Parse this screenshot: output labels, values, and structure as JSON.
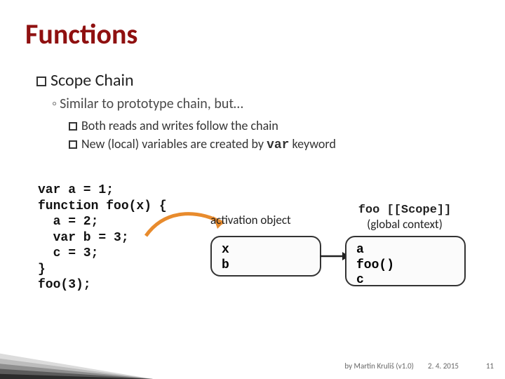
{
  "title": "Functions",
  "heading": "Scope Chain",
  "sub": "Similar to prototype chain, but…",
  "bullets": {
    "b1": "Both reads and writes follow the chain",
    "b2_a": "New (local) variables are created by ",
    "b2_code": "var",
    "b2_b": " keyword"
  },
  "code": "var a = 1;\nfunction foo(x) {\n  a = 2;\n  var b = 3;\n  c = 3;\n}\nfoo(3);",
  "labels": {
    "activation": "activation object",
    "scope_line1": "foo [[Scope]]",
    "scope_line2": "(global context)"
  },
  "box1": {
    "l1": "x",
    "l2": "b"
  },
  "box2": {
    "l1": "a",
    "l2": "foo()",
    "l3": "c"
  },
  "footer": {
    "credit": "by Martin Kruliš (v1.0)",
    "date": "2. 4. 2015",
    "page": "11"
  }
}
